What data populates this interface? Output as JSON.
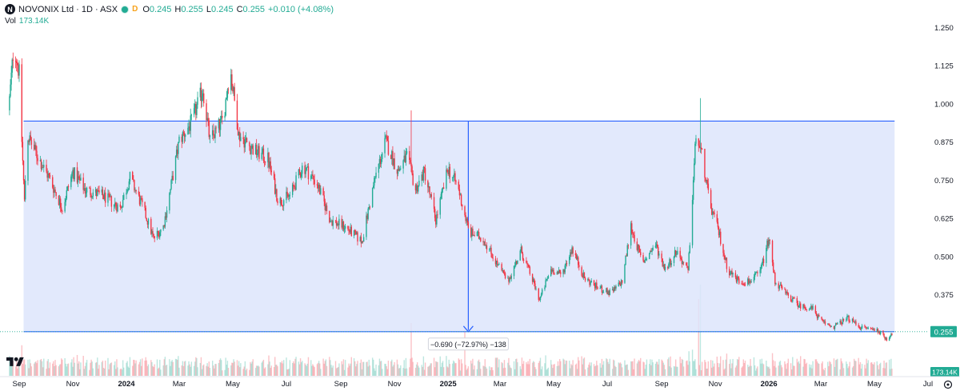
{
  "legend": {
    "symbol_initial": "N",
    "title": "NOVONIX Ltd · 1D · ASX",
    "status_badge": "D",
    "open_key": "O",
    "open": "0.245",
    "high_key": "H",
    "high": "0.255",
    "low_key": "L",
    "low": "0.245",
    "close_key": "C",
    "close": "0.255",
    "change": "+0.010 (+4.08%)",
    "volume_label": "Vol",
    "volume_value": "173.14K"
  },
  "measure_label": "−0.690 (−72.97%) −138",
  "colors": {
    "up": "#22ab94",
    "down": "#f23645",
    "measure": "#2962ff",
    "measure_fill": "#dde5fb"
  },
  "chart_data": {
    "type": "candlestick",
    "title": "NOVONIX Ltd · 1D · ASX",
    "ylim": [
      0.21,
      1.27
    ],
    "y_ticks": [
      1.25,
      1.125,
      1.0,
      0.875,
      0.75,
      0.625,
      0.5,
      0.375
    ],
    "x_ticks": [
      {
        "label": "Sep",
        "date": "2023-09-01"
      },
      {
        "label": "Nov",
        "date": "2023-11-01"
      },
      {
        "label": "2024",
        "date": "2024-01-01",
        "bold": true
      },
      {
        "label": "Mar",
        "date": "2024-03-01"
      },
      {
        "label": "May",
        "date": "2024-05-01"
      },
      {
        "label": "Jul",
        "date": "2024-07-01"
      },
      {
        "label": "Sep",
        "date": "2024-09-01"
      },
      {
        "label": "Nov",
        "date": "2024-11-01"
      },
      {
        "label": "2025",
        "date": "2025-01-01",
        "bold": true
      },
      {
        "label": "Mar",
        "date": "2025-03-01"
      },
      {
        "label": "May",
        "date": "2025-05-01"
      },
      {
        "label": "Jul",
        "date": "2025-07-01"
      },
      {
        "label": "Sep",
        "date": "2025-09-01"
      },
      {
        "label": "Nov",
        "date": "2025-11-01"
      },
      {
        "label": "2026",
        "date": "2026-01-01",
        "bold": true
      },
      {
        "label": "Mar",
        "date": "2026-03-01"
      },
      {
        "label": "May",
        "date": "2026-05-01"
      },
      {
        "label": "Jul",
        "date": "2026-07-01"
      }
    ],
    "price_path": [
      [
        "2023-08-20",
        0.98
      ],
      [
        "2023-08-26",
        1.2
      ],
      [
        "2023-09-01",
        1.1
      ],
      [
        "2023-09-04",
        0.88
      ],
      [
        "2023-09-07",
        0.68
      ],
      [
        "2023-09-10",
        0.9
      ],
      [
        "2023-09-20",
        0.84
      ],
      [
        "2023-10-05",
        0.76
      ],
      [
        "2023-10-20",
        0.66
      ],
      [
        "2023-11-01",
        0.78
      ],
      [
        "2023-11-15",
        0.72
      ],
      [
        "2023-12-05",
        0.7
      ],
      [
        "2023-12-25",
        0.66
      ],
      [
        "2024-01-05",
        0.76
      ],
      [
        "2024-01-20",
        0.66
      ],
      [
        "2024-02-01",
        0.56
      ],
      [
        "2024-02-12",
        0.6
      ],
      [
        "2024-02-20",
        0.72
      ],
      [
        "2024-03-01",
        0.88
      ],
      [
        "2024-03-15",
        0.94
      ],
      [
        "2024-03-28",
        1.05
      ],
      [
        "2024-04-05",
        0.88
      ],
      [
        "2024-04-20",
        0.95
      ],
      [
        "2024-04-28",
        1.12
      ],
      [
        "2024-05-08",
        0.9
      ],
      [
        "2024-05-25",
        0.85
      ],
      [
        "2024-06-10",
        0.82
      ],
      [
        "2024-06-22",
        0.68
      ],
      [
        "2024-07-05",
        0.7
      ],
      [
        "2024-07-20",
        0.8
      ],
      [
        "2024-08-05",
        0.74
      ],
      [
        "2024-08-20",
        0.62
      ],
      [
        "2024-09-05",
        0.6
      ],
      [
        "2024-09-25",
        0.55
      ],
      [
        "2024-10-10",
        0.76
      ],
      [
        "2024-10-22",
        0.88
      ],
      [
        "2024-11-05",
        0.78
      ],
      [
        "2024-11-15",
        0.83
      ],
      [
        "2024-11-25",
        0.72
      ],
      [
        "2024-12-05",
        0.78
      ],
      [
        "2024-12-18",
        0.62
      ],
      [
        "2025-01-01",
        0.79
      ],
      [
        "2025-01-12",
        0.73
      ],
      [
        "2025-01-25",
        0.58
      ],
      [
        "2025-02-10",
        0.56
      ],
      [
        "2025-02-25",
        0.48
      ],
      [
        "2025-03-10",
        0.42
      ],
      [
        "2025-03-25",
        0.52
      ],
      [
        "2025-04-05",
        0.44
      ],
      [
        "2025-04-15",
        0.36
      ],
      [
        "2025-04-28",
        0.46
      ],
      [
        "2025-05-10",
        0.44
      ],
      [
        "2025-05-22",
        0.53
      ],
      [
        "2025-06-05",
        0.43
      ],
      [
        "2025-06-20",
        0.4
      ],
      [
        "2025-07-05",
        0.38
      ],
      [
        "2025-07-18",
        0.42
      ],
      [
        "2025-07-28",
        0.6
      ],
      [
        "2025-08-10",
        0.48
      ],
      [
        "2025-08-25",
        0.54
      ],
      [
        "2025-09-05",
        0.46
      ],
      [
        "2025-09-18",
        0.52
      ],
      [
        "2025-10-01",
        0.45
      ],
      [
        "2025-10-10",
        0.9
      ],
      [
        "2025-10-18",
        0.82
      ],
      [
        "2025-10-25",
        0.68
      ],
      [
        "2025-11-05",
        0.58
      ],
      [
        "2025-11-15",
        0.46
      ],
      [
        "2025-11-28",
        0.42
      ],
      [
        "2025-12-10",
        0.42
      ],
      [
        "2025-12-22",
        0.45
      ],
      [
        "2026-01-01",
        0.56
      ],
      [
        "2026-01-08",
        0.42
      ],
      [
        "2026-01-20",
        0.38
      ],
      [
        "2026-02-05",
        0.34
      ],
      [
        "2026-02-20",
        0.33
      ],
      [
        "2026-03-01",
        0.29
      ],
      [
        "2026-03-15",
        0.27
      ],
      [
        "2026-04-01",
        0.3
      ],
      [
        "2026-04-15",
        0.27
      ],
      [
        "2026-05-05",
        0.26
      ],
      [
        "2026-05-15",
        0.23
      ],
      [
        "2026-05-22",
        0.255
      ]
    ],
    "price_spikes": [
      {
        "date": "2024-11-20",
        "high": 0.98
      },
      {
        "date": "2025-10-15",
        "high": 1.02
      }
    ],
    "volume_spikes": [
      {
        "date": "2025-10-15",
        "scale": 0.95
      },
      {
        "date": "2025-10-13",
        "scale": 0.8
      },
      {
        "date": "2024-11-20",
        "scale": 0.55
      },
      {
        "date": "2025-01-20",
        "scale": 0.5
      }
    ],
    "measure": {
      "start_date": "2023-09-06",
      "end_date": "2026-05-24",
      "from_price": 0.945,
      "to_price": 0.255,
      "arrow_date": "2025-01-24",
      "change": -0.69,
      "change_pct": -72.97,
      "bars": -138
    },
    "current_price": 0.255,
    "current_volume": "173.14K",
    "price_axis_side": "right",
    "grid": false
  }
}
